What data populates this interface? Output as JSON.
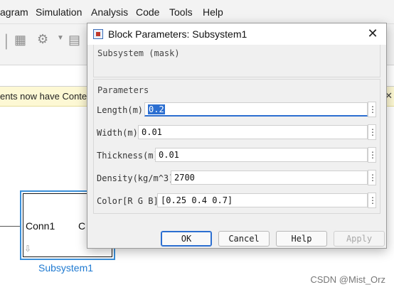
{
  "background": {
    "menu": [
      "agram",
      "Simulation",
      "Analysis",
      "Code",
      "Tools",
      "Help"
    ],
    "notification": "ents now have Content l",
    "notification_close": "✕",
    "block": {
      "port_left": "Conn1",
      "port_right": "C",
      "name": "Subsystem1"
    },
    "watermark": "CSDN @Mist_Orz"
  },
  "dialog": {
    "title": "Block Parameters: Subsystem1",
    "close": "✕",
    "mask_section": "Subsystem (mask)",
    "params_section": "Parameters",
    "params": [
      {
        "label": "Length(m)",
        "value": "0.2",
        "more": "⋮",
        "selected": true
      },
      {
        "label": "Width(m)",
        "value": "0.01",
        "more": "⋮"
      },
      {
        "label": "Thickness(m)",
        "value": "0.01",
        "more": "⋮"
      },
      {
        "label": "Density(kg/m^3)",
        "value": "2700",
        "more": "⋮"
      },
      {
        "label": "Color[R G B]",
        "value": "[0.25 0.4 0.7]",
        "more": "⋮"
      }
    ],
    "buttons": {
      "ok": "OK",
      "cancel": "Cancel",
      "help": "Help",
      "apply": "Apply"
    }
  },
  "colors": {
    "accent": "#2c6fd1",
    "block_border": "#3a8fd8",
    "notification_bg": "#fdf8d4"
  }
}
